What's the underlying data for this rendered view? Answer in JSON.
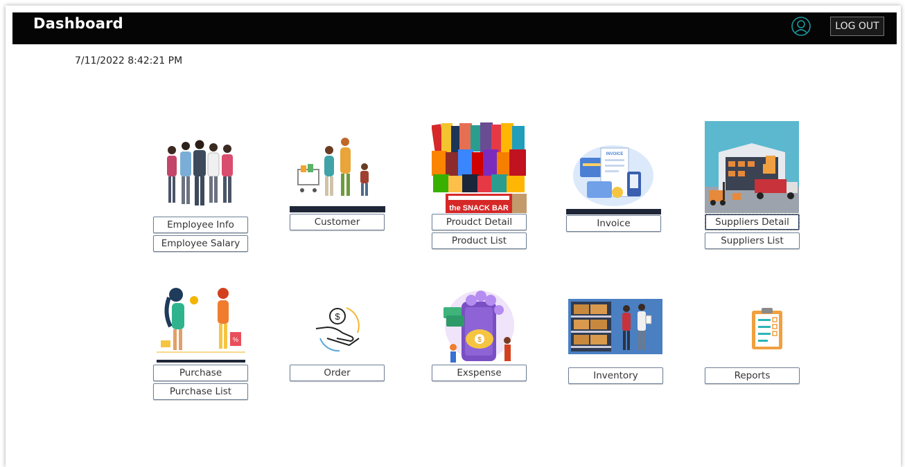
{
  "header": {
    "title": "Dashboard",
    "logout_label": "LOG OUT"
  },
  "datetime": "7/11/2022 8:42:21 PM",
  "tiles": {
    "employee": {
      "icon": "employees-group-icon",
      "buttons": [
        "Employee Info",
        "Employee Salary"
      ]
    },
    "customer": {
      "icon": "family-shopping-icon",
      "buttons": [
        "Customer"
      ]
    },
    "product": {
      "icon": "snack-bar-box-icon",
      "image_text": "the SNACK BAR",
      "buttons": [
        "Proudct Detail",
        "Product List"
      ]
    },
    "invoice": {
      "icon": "invoice-payment-icon",
      "image_text": "INVOICE",
      "buttons": [
        "Invoice"
      ]
    },
    "suppliers": {
      "icon": "warehouse-forklift-icon",
      "buttons": [
        "Suppliers Detail",
        "Suppliers List"
      ]
    },
    "purchase": {
      "icon": "shopping-women-icon",
      "buttons": [
        "Purchase",
        "Purchase List"
      ]
    },
    "order": {
      "icon": "hand-coin-icon",
      "buttons": [
        "Order"
      ]
    },
    "expense": {
      "icon": "piggy-bank-phone-icon",
      "buttons": [
        "Exspense"
      ]
    },
    "inventory": {
      "icon": "inventory-shelves-icon",
      "buttons": [
        "Inventory"
      ]
    },
    "reports": {
      "icon": "clipboard-checklist-icon",
      "buttons": [
        "Reports"
      ]
    }
  },
  "colors": {
    "titlebar": "#050505",
    "button_border": "#6e7f96",
    "accent_teal": "#1a9aa0"
  }
}
